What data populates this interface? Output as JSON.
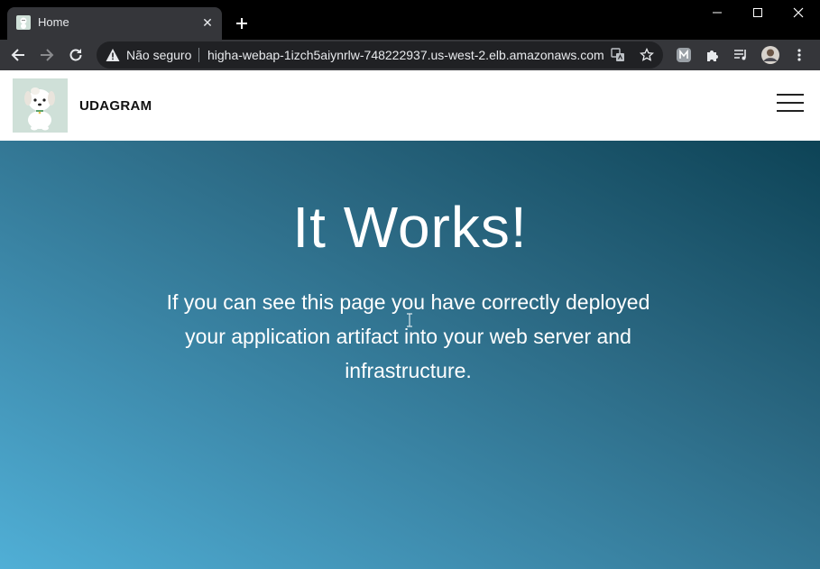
{
  "browser": {
    "tab": {
      "title": "Home",
      "close_glyph": "✕",
      "favicon": "puppy-favicon-icon"
    },
    "new_tab_icon": "plus-icon",
    "window_controls": [
      "minimize-icon",
      "maximize-icon",
      "close-icon"
    ],
    "toolbar": {
      "back_icon": "arrow-left-icon",
      "forward_icon": "arrow-right-icon",
      "reload_icon": "reload-icon"
    },
    "omnibox": {
      "security_label": "Não seguro",
      "url": "higha-webap-1izch5aiynrlw-748222937.us-west-2.elb.amazonaws.com",
      "translate_icon": "translate-icon",
      "bookmark_icon": "star-icon"
    },
    "extensions": [
      "m-extension-icon",
      "puzzle-extensions-icon",
      "media-queue-icon",
      "profile-avatar-icon",
      "kebab-menu-icon"
    ]
  },
  "site": {
    "brand": "UDAGRAM",
    "logo_icon": "puppy-logo-icon",
    "menu_icon": "hamburger-menu-icon",
    "hero": {
      "title": "It Works!",
      "text": "If you can see this page you have correctly deployed your application artifact into your web server and infrastructure."
    }
  },
  "colors": {
    "tabstrip": "#000000",
    "toolbar": "#35363a",
    "omnibox": "#202124",
    "hero_gradient_start": "#50afd6",
    "hero_gradient_end": "#0d4356",
    "logo_background": "#cfe0d8"
  }
}
